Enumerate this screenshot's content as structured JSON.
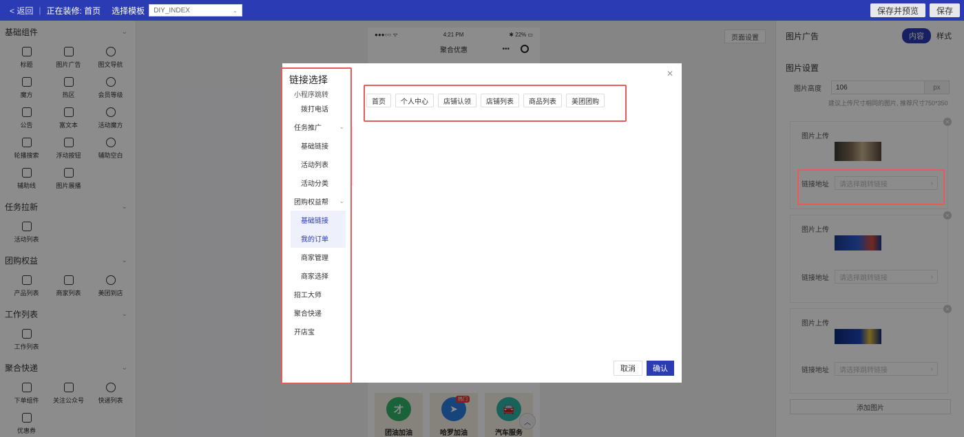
{
  "topbar": {
    "back": "< 返回",
    "editing": "正在装修: 首页",
    "template_label": "选择模板",
    "template_value": "DIY_INDEX",
    "save_preview": "保存并预览",
    "save": "保存"
  },
  "left": {
    "groups": [
      {
        "title": "基础组件",
        "items": [
          "标题",
          "图片广告",
          "图文导航",
          "魔方",
          "热区",
          "会员等级",
          "公告",
          "富文本",
          "活动魔方",
          "轮播搜索",
          "浮动按钮",
          "辅助空白",
          "辅助线",
          "图片展播"
        ]
      },
      {
        "title": "任务拉新",
        "items": [
          "活动列表"
        ]
      },
      {
        "title": "团购权益",
        "items": [
          "产品列表",
          "商家列表",
          "美团到店"
        ]
      },
      {
        "title": "工作列表",
        "items": [
          "工作列表"
        ]
      },
      {
        "title": "聚合快递",
        "items": [
          "下单组件",
          "关注公众号",
          "快递列表",
          "优惠券"
        ]
      }
    ]
  },
  "phone": {
    "signal": "●●●○○ ᯤ",
    "time": "4:21 PM",
    "battery": "✱ 22% ▭",
    "title": "聚合优惠",
    "services": [
      {
        "name": "团油加油",
        "glyph": "才",
        "color": "#2fb36b"
      },
      {
        "name": "哈罗加油",
        "glyph": "➤",
        "color": "#2a7de1",
        "badge": "热门"
      },
      {
        "name": "汽车服务",
        "glyph": "🚘",
        "color": "#2bb3a3"
      }
    ]
  },
  "canvas": {
    "page_settings": "页面设置"
  },
  "right": {
    "title": "图片广告",
    "tab_content": "内容",
    "tab_style": "样式",
    "section": "图片设置",
    "height_label": "图片高度",
    "height_value": "106",
    "height_unit": "px",
    "hint": "建议上传尺寸相同的图片, 推荐尺寸750*350",
    "upload_label": "图片上传",
    "link_label": "链接地址",
    "link_placeholder": "请选择跳转链接",
    "add_image": "添加图片"
  },
  "modal": {
    "title": "链接选择",
    "side_items": [
      {
        "label": "小程序跳转",
        "cut": true
      },
      {
        "label": "拨打电话",
        "sub": true
      },
      {
        "label": "任务推广",
        "parent": true
      },
      {
        "label": "基础链接",
        "sub": true
      },
      {
        "label": "活动列表",
        "sub": true
      },
      {
        "label": "活动分类",
        "sub": true
      },
      {
        "label": "团购权益帮",
        "parent": true
      },
      {
        "label": "基础链接",
        "sub": true,
        "active": true
      },
      {
        "label": "我的订单",
        "sub": true,
        "active": true
      },
      {
        "label": "商家管理",
        "sub": true
      },
      {
        "label": "商家选择",
        "sub": true
      },
      {
        "label": "招工大师"
      },
      {
        "label": "聚合快递"
      },
      {
        "label": "开店宝"
      }
    ],
    "tags": [
      "首页",
      "个人中心",
      "店铺认领",
      "店铺列表",
      "商品列表",
      "美团团购"
    ],
    "cancel": "取消",
    "confirm": "确认"
  }
}
